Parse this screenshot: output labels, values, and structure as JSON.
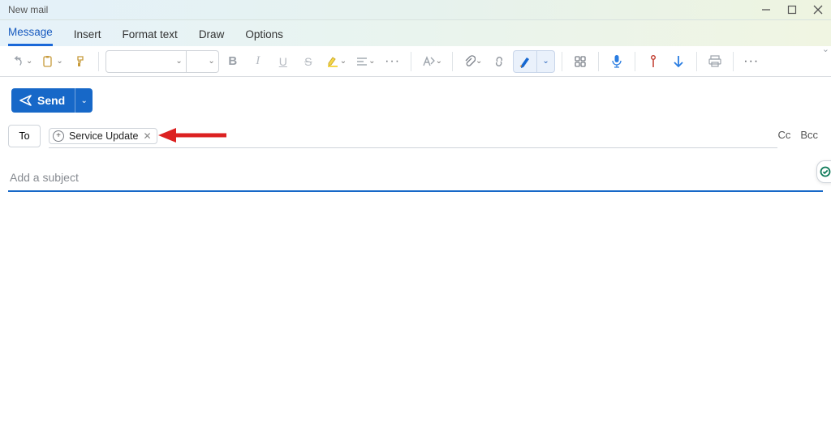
{
  "window": {
    "title": "New mail"
  },
  "tabs": {
    "items": [
      {
        "label": "Message"
      },
      {
        "label": "Insert"
      },
      {
        "label": "Format text"
      },
      {
        "label": "Draw"
      },
      {
        "label": "Options"
      }
    ],
    "activeIndex": 0
  },
  "send": {
    "label": "Send"
  },
  "fields": {
    "to_button": "To",
    "cc": "Cc",
    "bcc": "Bcc",
    "subject_placeholder": "Add a subject"
  },
  "recipients": {
    "to": [
      {
        "name": "Service Update"
      }
    ]
  },
  "colors": {
    "accent": "#1768c8"
  }
}
